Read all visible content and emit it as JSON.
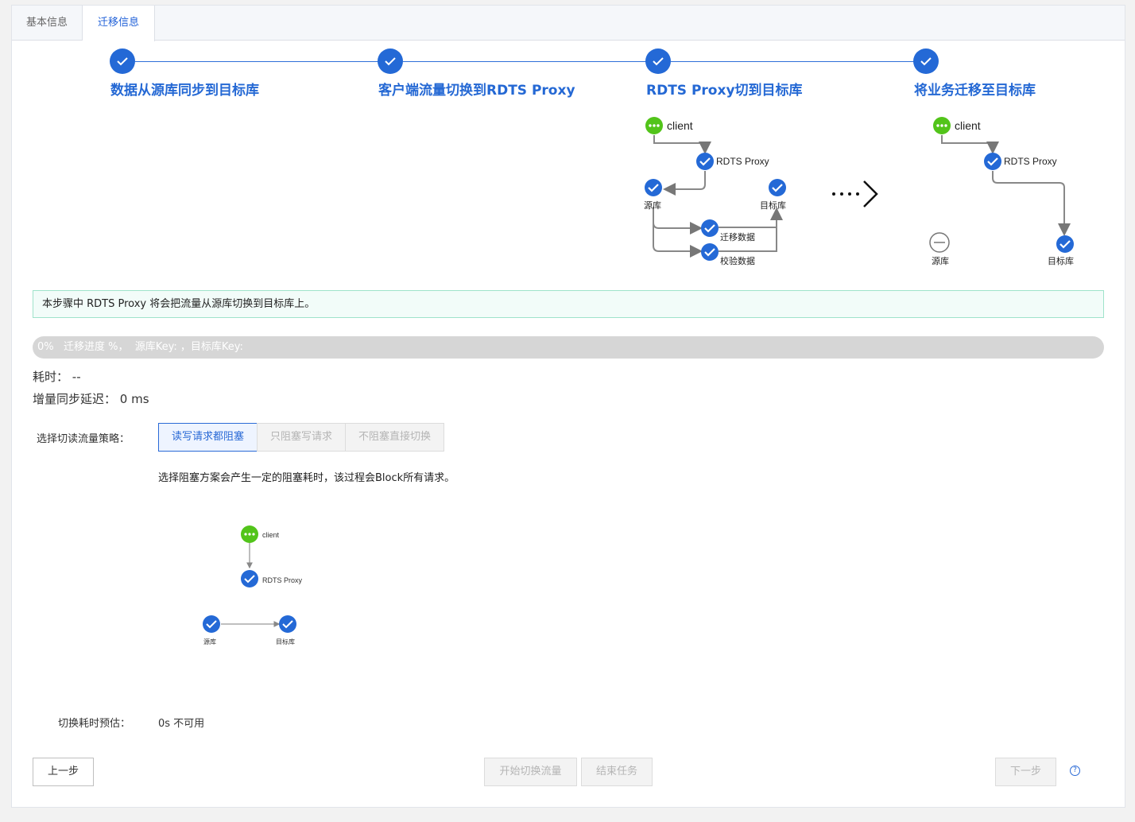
{
  "tabs": {
    "basic": "基本信息",
    "migrate": "迁移信息"
  },
  "steps": [
    "数据从源库同步到目标库",
    "客户端流量切换到RDTS Proxy",
    "RDTS Proxy切到目标库",
    "将业务迁移至目标库"
  ],
  "diagram_before": {
    "client": "client",
    "proxy": "RDTS Proxy",
    "source": "源库",
    "target": "目标库",
    "migrate_data": "迁移数据",
    "verify_data": "校验数据"
  },
  "diagram_after": {
    "client": "client",
    "proxy": "RDTS Proxy",
    "source": "源库",
    "target": "目标库"
  },
  "info_message": "本步骤中 RDTS Proxy 将会把流量从源库切换到目标库上。",
  "progress": {
    "text": "0%   迁移进度 %，  源库Key: ，目标库Key:",
    "percent": 0
  },
  "elapsed": {
    "label": "耗时：",
    "value": "--"
  },
  "sync_delay": {
    "label": "增量同步延迟：",
    "value": "0 ms"
  },
  "strategy": {
    "label": "选择切读流量策略：",
    "options": [
      "读写请求都阻塞",
      "只阻塞写请求",
      "不阻塞直接切换"
    ],
    "selected": "读写请求都阻塞",
    "hint": "选择阻塞方案会产生一定的阻塞耗时，该过程会Block所有请求。"
  },
  "diagram_small": {
    "client": "client",
    "proxy": "RDTS Proxy",
    "source": "源库",
    "target": "目标库"
  },
  "estimate": {
    "label": "切换耗时预估：",
    "value": "0s 不可用"
  },
  "buttons": {
    "prev": "上一步",
    "start": "开始切换流量",
    "end": "结束任务",
    "next": "下一步",
    "help": "?"
  },
  "colors": {
    "primary": "#2469d6",
    "client_green": "#52c41a",
    "info_bg": "#f2fcf9"
  },
  "icons": [
    "check-icon",
    "more-dots-icon",
    "minus-circle-icon",
    "arrow-right-icon",
    "help-icon"
  ]
}
